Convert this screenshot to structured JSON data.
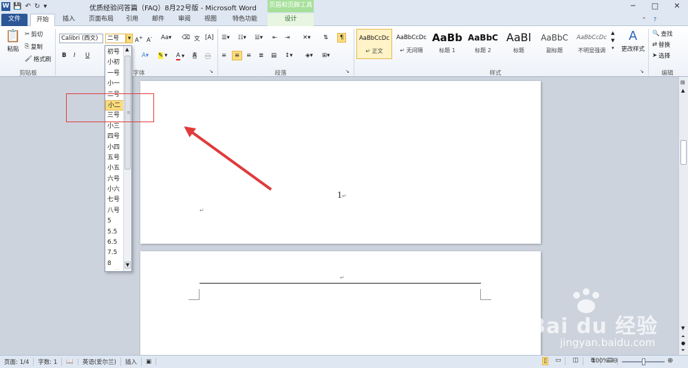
{
  "window": {
    "title": "优质经验问答篇（FAQ）8月22号版 - Microsoft Word",
    "context_tab": "页眉和页脚工具",
    "app_icon": "W",
    "controls": [
      "─",
      "□",
      "✕"
    ]
  },
  "tabs": [
    {
      "label": "文件"
    },
    {
      "label": "开始"
    },
    {
      "label": "插入"
    },
    {
      "label": "页面布局"
    },
    {
      "label": "引用"
    },
    {
      "label": "邮件"
    },
    {
      "label": "审阅"
    },
    {
      "label": "视图"
    },
    {
      "label": "特色功能"
    },
    {
      "label": "设计"
    }
  ],
  "clipboard": {
    "paste": "粘贴",
    "cut": "剪切",
    "copy": "复制",
    "format_painter": "格式刷",
    "group": "剪贴板"
  },
  "font": {
    "name": "Calibri (西文)",
    "size": "二号",
    "group": "字体",
    "bold": "B",
    "italic": "I",
    "underline": "U"
  },
  "paragraph": {
    "group": "段落"
  },
  "styles": {
    "group": "样式",
    "items": [
      {
        "preview": "AaBbCcDc",
        "name": "↵ 正文"
      },
      {
        "preview": "AaBbCcDc",
        "name": "↵ 无间隔"
      },
      {
        "preview": "AaBb",
        "name": "标题 1"
      },
      {
        "preview": "AaBbC",
        "name": "标题 2"
      },
      {
        "preview": "AaBl",
        "name": "标题"
      },
      {
        "preview": "AaBbC",
        "name": "副标题"
      },
      {
        "preview": "AaBbCcDc",
        "name": "不明显强调"
      }
    ],
    "change_styles": "更改样式"
  },
  "editing": {
    "find": "查找",
    "replace": "替换",
    "select": "选择",
    "group": "编辑"
  },
  "font_size_options": [
    "初号",
    "小初",
    "一号",
    "小一",
    "二号",
    "小二",
    "三号",
    "小三",
    "四号",
    "小四",
    "五号",
    "小五",
    "六号",
    "小六",
    "七号",
    "八号",
    "5",
    "5.5",
    "6.5",
    "7.5",
    "8"
  ],
  "selected_font_size": "小二",
  "document": {
    "page_number": "1",
    "para_mark": "↵"
  },
  "status": {
    "page": "页面: 1/4",
    "words": "字数: 1",
    "language": "英语(爱尔兰)",
    "insert": "插入",
    "zoom": "100%"
  },
  "watermark": {
    "brand": "Bai du 经验",
    "url": "jingyan.baidu.com"
  }
}
